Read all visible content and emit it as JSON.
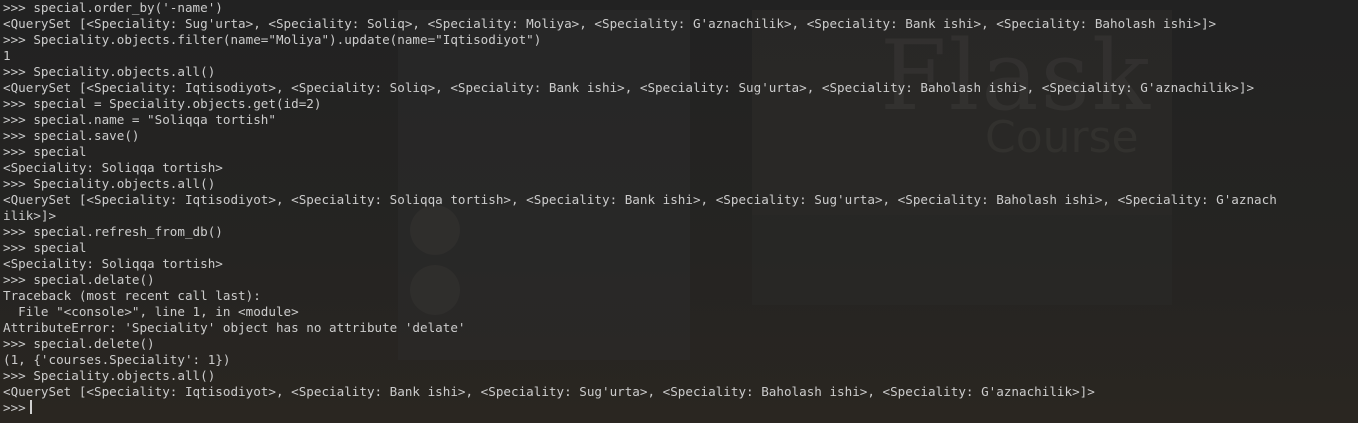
{
  "terminal": {
    "lines": [
      ">>> special.order_by('-name')",
      "<QuerySet [<Speciality: Sug'urta>, <Speciality: Soliq>, <Speciality: Moliya>, <Speciality: G'aznachilik>, <Speciality: Bank ishi>, <Speciality: Baholash ishi>]>",
      ">>> Speciality.objects.filter(name=\"Moliya\").update(name=\"Iqtisodiyot\")",
      "1",
      ">>> Speciality.objects.all()",
      "<QuerySet [<Speciality: Iqtisodiyot>, <Speciality: Soliq>, <Speciality: Bank ishi>, <Speciality: Sug'urta>, <Speciality: Baholash ishi>, <Speciality: G'aznachilik>]>",
      ">>> special = Speciality.objects.get(id=2)",
      ">>> special.name = \"Soliqqa tortish\"",
      ">>> special.save()",
      ">>> special",
      "<Speciality: Soliqqa tortish>",
      ">>> Speciality.objects.all()",
      "<QuerySet [<Speciality: Iqtisodiyot>, <Speciality: Soliqqa tortish>, <Speciality: Bank ishi>, <Speciality: Sug'urta>, <Speciality: Baholash ishi>, <Speciality: G'aznach",
      "ilik>]>",
      ">>> special.refresh_from_db()",
      ">>> special",
      "<Speciality: Soliqqa tortish>",
      ">>> special.delate()",
      "Traceback (most recent call last):",
      "  File \"<console>\", line 1, in <module>",
      "AttributeError: 'Speciality' object has no attribute 'delate'",
      ">>> special.delete()",
      "(1, {'courses.Speciality': 1})",
      ">>> Speciality.objects.all()",
      "<QuerySet [<Speciality: Iqtisodiyot>, <Speciality: Bank ishi>, <Speciality: Sug'urta>, <Speciality: Baholash ishi>, <Speciality: G'aznachilik>]>"
    ],
    "prompt": ">>>"
  },
  "background": {
    "logo_text": "Flask",
    "logo_subtext": "Course"
  },
  "colors": {
    "terminal_bg": "#1e1e1e",
    "text": "#cccccc",
    "cursor": "#d0d0d0"
  }
}
